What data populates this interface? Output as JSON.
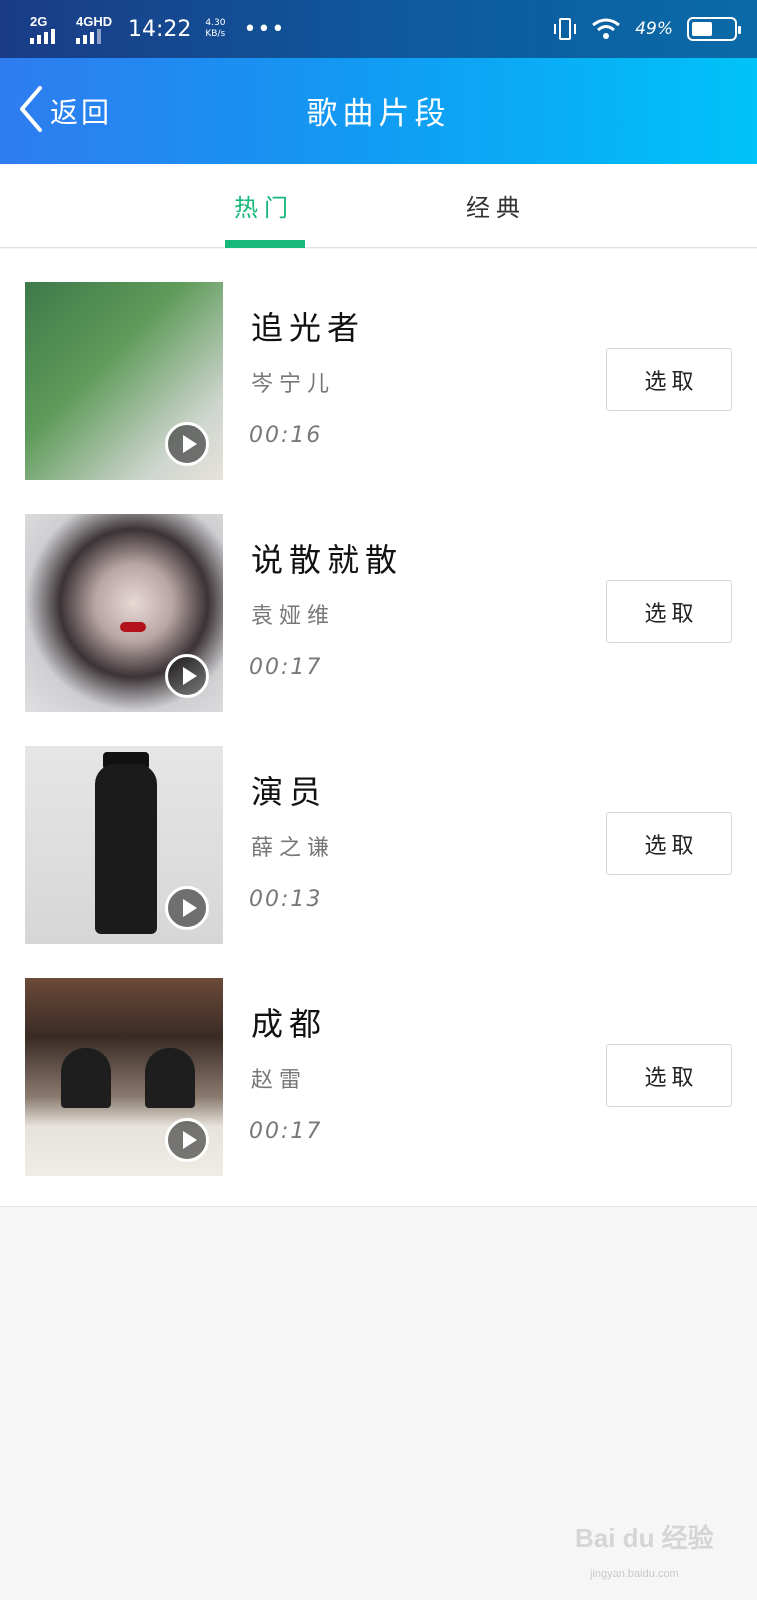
{
  "status_bar": {
    "net1": "2G",
    "net2": "4GHD",
    "time": "14:22",
    "speed_value": "4.30",
    "speed_unit": "KB/s",
    "more": "•••",
    "battery_percent": "49%",
    "battery_level": 0.49,
    "icons": [
      "vibrate-icon",
      "wifi-icon",
      "battery-icon"
    ]
  },
  "header": {
    "back_label": "返回",
    "title": "歌曲片段",
    "colors": {
      "start": "#2f7cf0",
      "end": "#00c3f9"
    }
  },
  "tabs": [
    {
      "label": "热门",
      "active": true
    },
    {
      "label": "经典",
      "active": false
    }
  ],
  "accent_color": "#17b87a",
  "songs": [
    {
      "title": "追光者",
      "artist": "岑宁儿",
      "duration": "00:16",
      "action": "选取"
    },
    {
      "title": "说散就散",
      "artist": "袁娅维",
      "duration": "00:17",
      "action": "选取"
    },
    {
      "title": "演员",
      "artist": "薛之谦",
      "duration": "00:13",
      "action": "选取"
    },
    {
      "title": "成都",
      "artist": "赵雷",
      "duration": "00:17",
      "action": "选取"
    }
  ],
  "watermark": {
    "main": "Bai du 经验",
    "sub": "jingyan.baidu.com"
  }
}
